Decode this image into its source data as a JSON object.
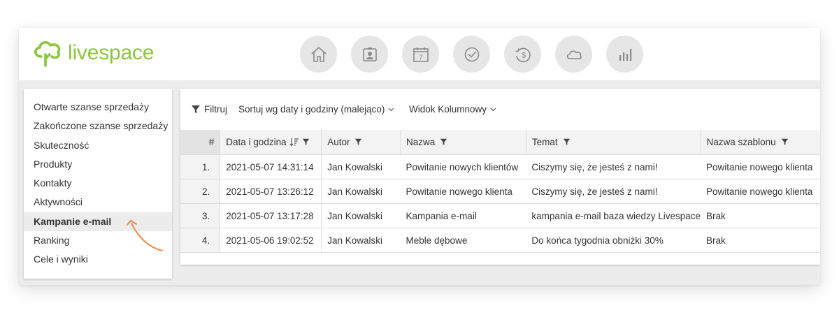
{
  "brand": {
    "name": "livespace",
    "color": "#8cc63f"
  },
  "nav": [
    {
      "icon": "home-icon"
    },
    {
      "icon": "contacts-icon"
    },
    {
      "icon": "calendar-icon",
      "label": "7"
    },
    {
      "icon": "tasks-check-icon"
    },
    {
      "icon": "deals-money-icon"
    },
    {
      "icon": "cloud-icon"
    },
    {
      "icon": "reports-chart-icon"
    }
  ],
  "sidebar": {
    "items": [
      {
        "label": "Otwarte szanse sprzedaży"
      },
      {
        "label": "Zakończone szanse sprzedaży"
      },
      {
        "label": "Skuteczność"
      },
      {
        "label": "Produkty"
      },
      {
        "label": "Kontakty"
      },
      {
        "label": "Aktywności"
      },
      {
        "label": "Kampanie e-mail",
        "active": true
      },
      {
        "label": "Ranking"
      },
      {
        "label": "Cele i wyniki"
      }
    ]
  },
  "toolbar": {
    "filter_label": "Filtruj",
    "sort_label": "Sortuj wg daty i godziny (malejąco)",
    "view_label": "Widok Kolumnowy"
  },
  "table": {
    "headers": {
      "index": "#",
      "date": "Data i godzina",
      "author": "Autor",
      "name": "Nazwa",
      "subject": "Temat",
      "template": "Nazwa szablonu"
    },
    "rows": [
      {
        "index": "1.",
        "date": "2021-05-07 14:31:14",
        "author": "Jan Kowalski",
        "name": "Powitanie nowych klientów",
        "subject": "Ciszymy się, że jesteś z nami!",
        "template": "Powitanie nowego klienta"
      },
      {
        "index": "2.",
        "date": "2021-05-07 13:26:12",
        "author": "Jan Kowalski",
        "name": "Powitanie nowego klienta",
        "subject": "Ciszymy się, że jesteś z nami!",
        "template": "Powitanie nowego klienta"
      },
      {
        "index": "3.",
        "date": "2021-05-07 13:17:28",
        "author": "Jan Kowalski",
        "name": "Kampania e-mail",
        "subject": "kampania e-mail baza wiedzy Livespace",
        "template": "Brak"
      },
      {
        "index": "4.",
        "date": "2021-05-06 19:02:52",
        "author": "Jan Kowalski",
        "name": "Meble dębowe",
        "subject": "Do końca tygodnia obniżki 30%",
        "template": "Brak"
      }
    ]
  },
  "colors": {
    "accent": "#8cc63f",
    "arrow": "#f08a4b",
    "icon_gray": "#8a8a8a"
  }
}
